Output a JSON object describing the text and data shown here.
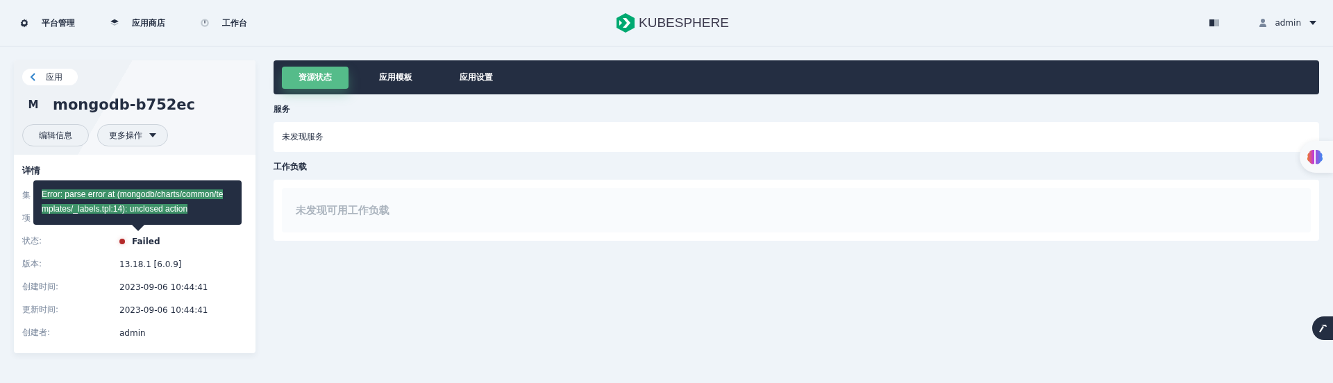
{
  "top_nav": [
    {
      "label": "平台管理"
    },
    {
      "label": "应用商店"
    },
    {
      "label": "工作台"
    }
  ],
  "logo": {
    "text": "KUBESPHERE"
  },
  "user": {
    "name": "admin"
  },
  "app": {
    "back_label": "应用",
    "avatar": "M",
    "name": "mongodb-b752ec",
    "actions": [
      {
        "label": "编辑信息",
        "dropdown": false
      },
      {
        "label": "更多操作",
        "dropdown": true
      }
    ]
  },
  "details": {
    "title": "详情",
    "rows": [
      {
        "label": "集",
        "kind": "hidden"
      },
      {
        "label": "项",
        "kind": "hidden"
      },
      {
        "label": "状态:",
        "kind": "status",
        "value": "Failed",
        "color": "#b42a2a"
      },
      {
        "label": "版本:",
        "kind": "text",
        "value": "13.18.1 [6.0.9]"
      },
      {
        "label": "创建时间:",
        "kind": "text",
        "value": "2023-09-06 10:44:41"
      },
      {
        "label": "更新时间:",
        "kind": "text",
        "value": "2023-09-06 10:44:41"
      },
      {
        "label": "创建者:",
        "kind": "text",
        "value": "admin"
      }
    ]
  },
  "tooltip": {
    "lines": [
      "Error: parse error at (mongodb/charts/common/te",
      "mplates/_labels.tpl:14): unclosed action"
    ]
  },
  "tabs": [
    {
      "label": "资源状态",
      "selected": true
    },
    {
      "label": "应用模板",
      "selected": false
    },
    {
      "label": "应用设置",
      "selected": false
    }
  ],
  "services": {
    "title": "服务",
    "empty": "未发现服务"
  },
  "workloads": {
    "title": "工作负载",
    "empty": "未发现可用工作负载"
  }
}
